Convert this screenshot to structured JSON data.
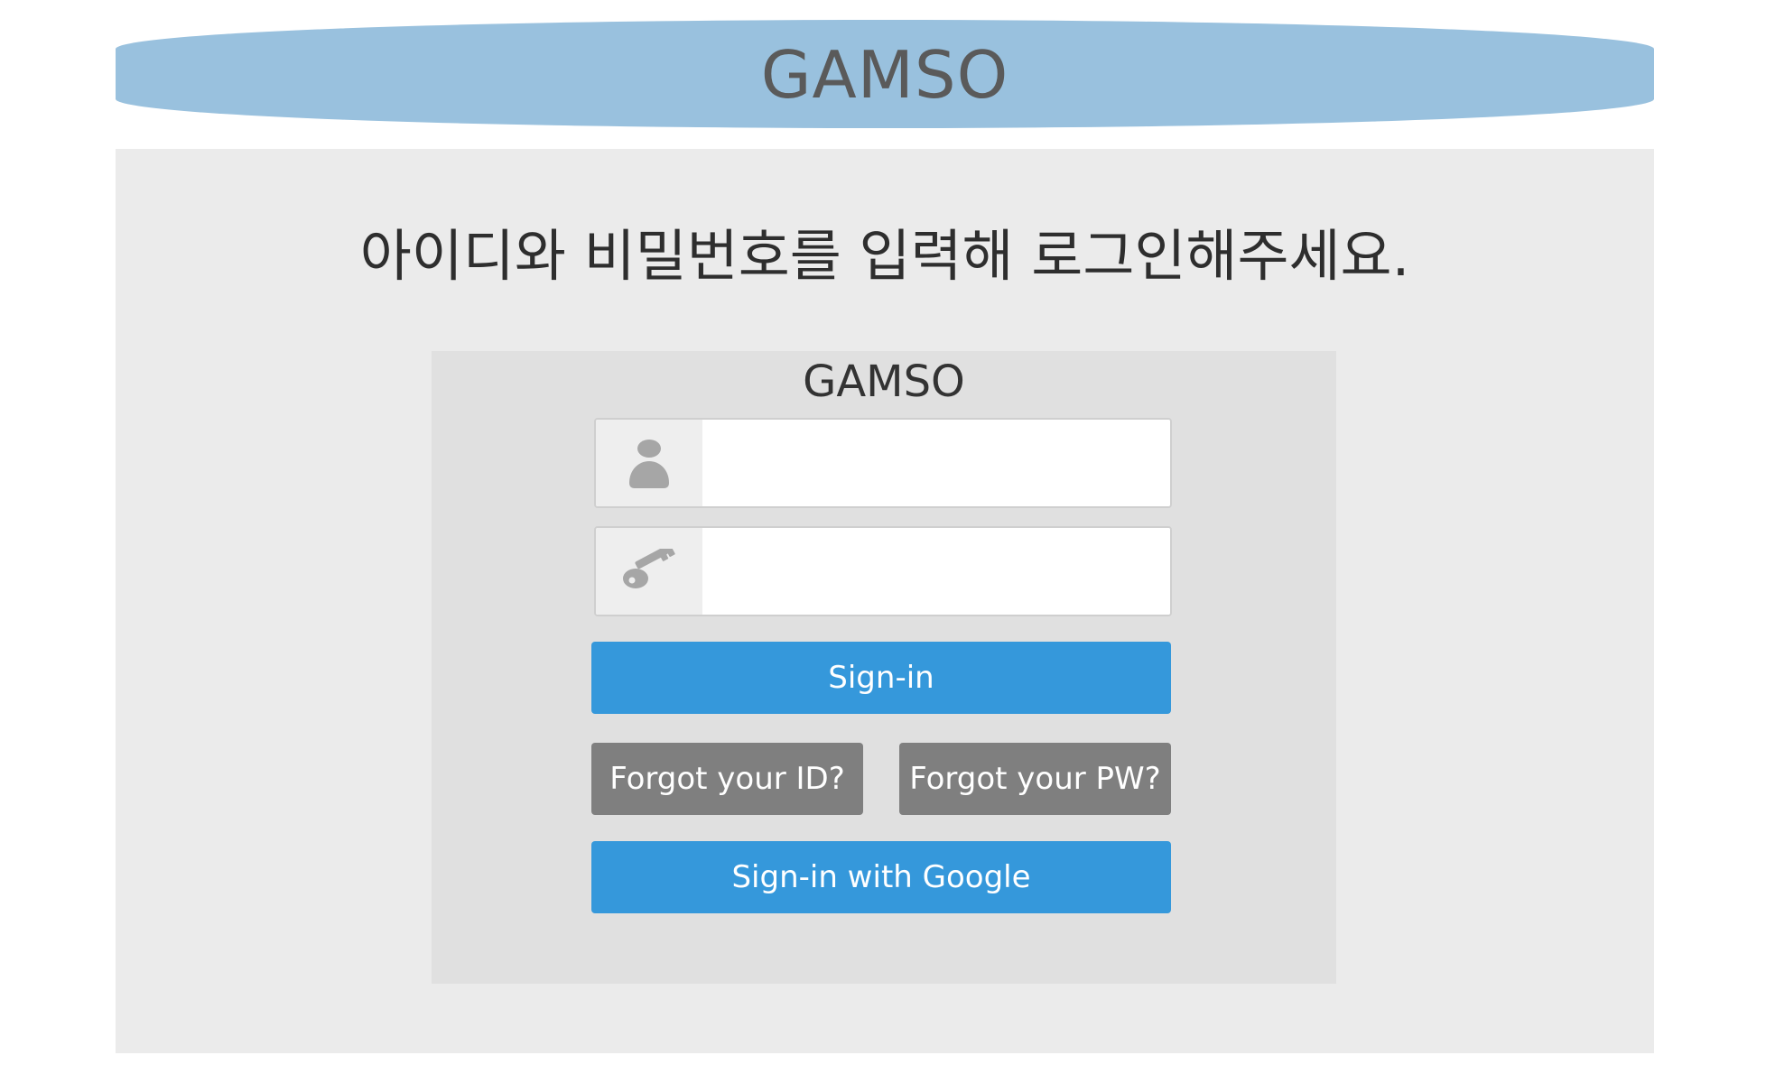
{
  "header": {
    "title": "GAMSO"
  },
  "main": {
    "instruction": "아이디와 비밀번호를 입력해 로그인해주세요."
  },
  "login": {
    "title": "GAMSO",
    "username": {
      "icon": "user-icon",
      "value": "",
      "placeholder": ""
    },
    "password": {
      "icon": "key-icon",
      "value": "",
      "placeholder": ""
    },
    "signin_label": "Sign-in",
    "forgot_id_label": "Forgot your ID?",
    "forgot_pw_label": "Forgot your PW?",
    "google_label": "Sign-in with Google"
  },
  "colors": {
    "header_bg": "#99c1de",
    "primary_button": "#3598db",
    "secondary_button": "#7f7f7f",
    "panel_bg": "#ebebeb",
    "login_box_bg": "#e0e0e0"
  }
}
